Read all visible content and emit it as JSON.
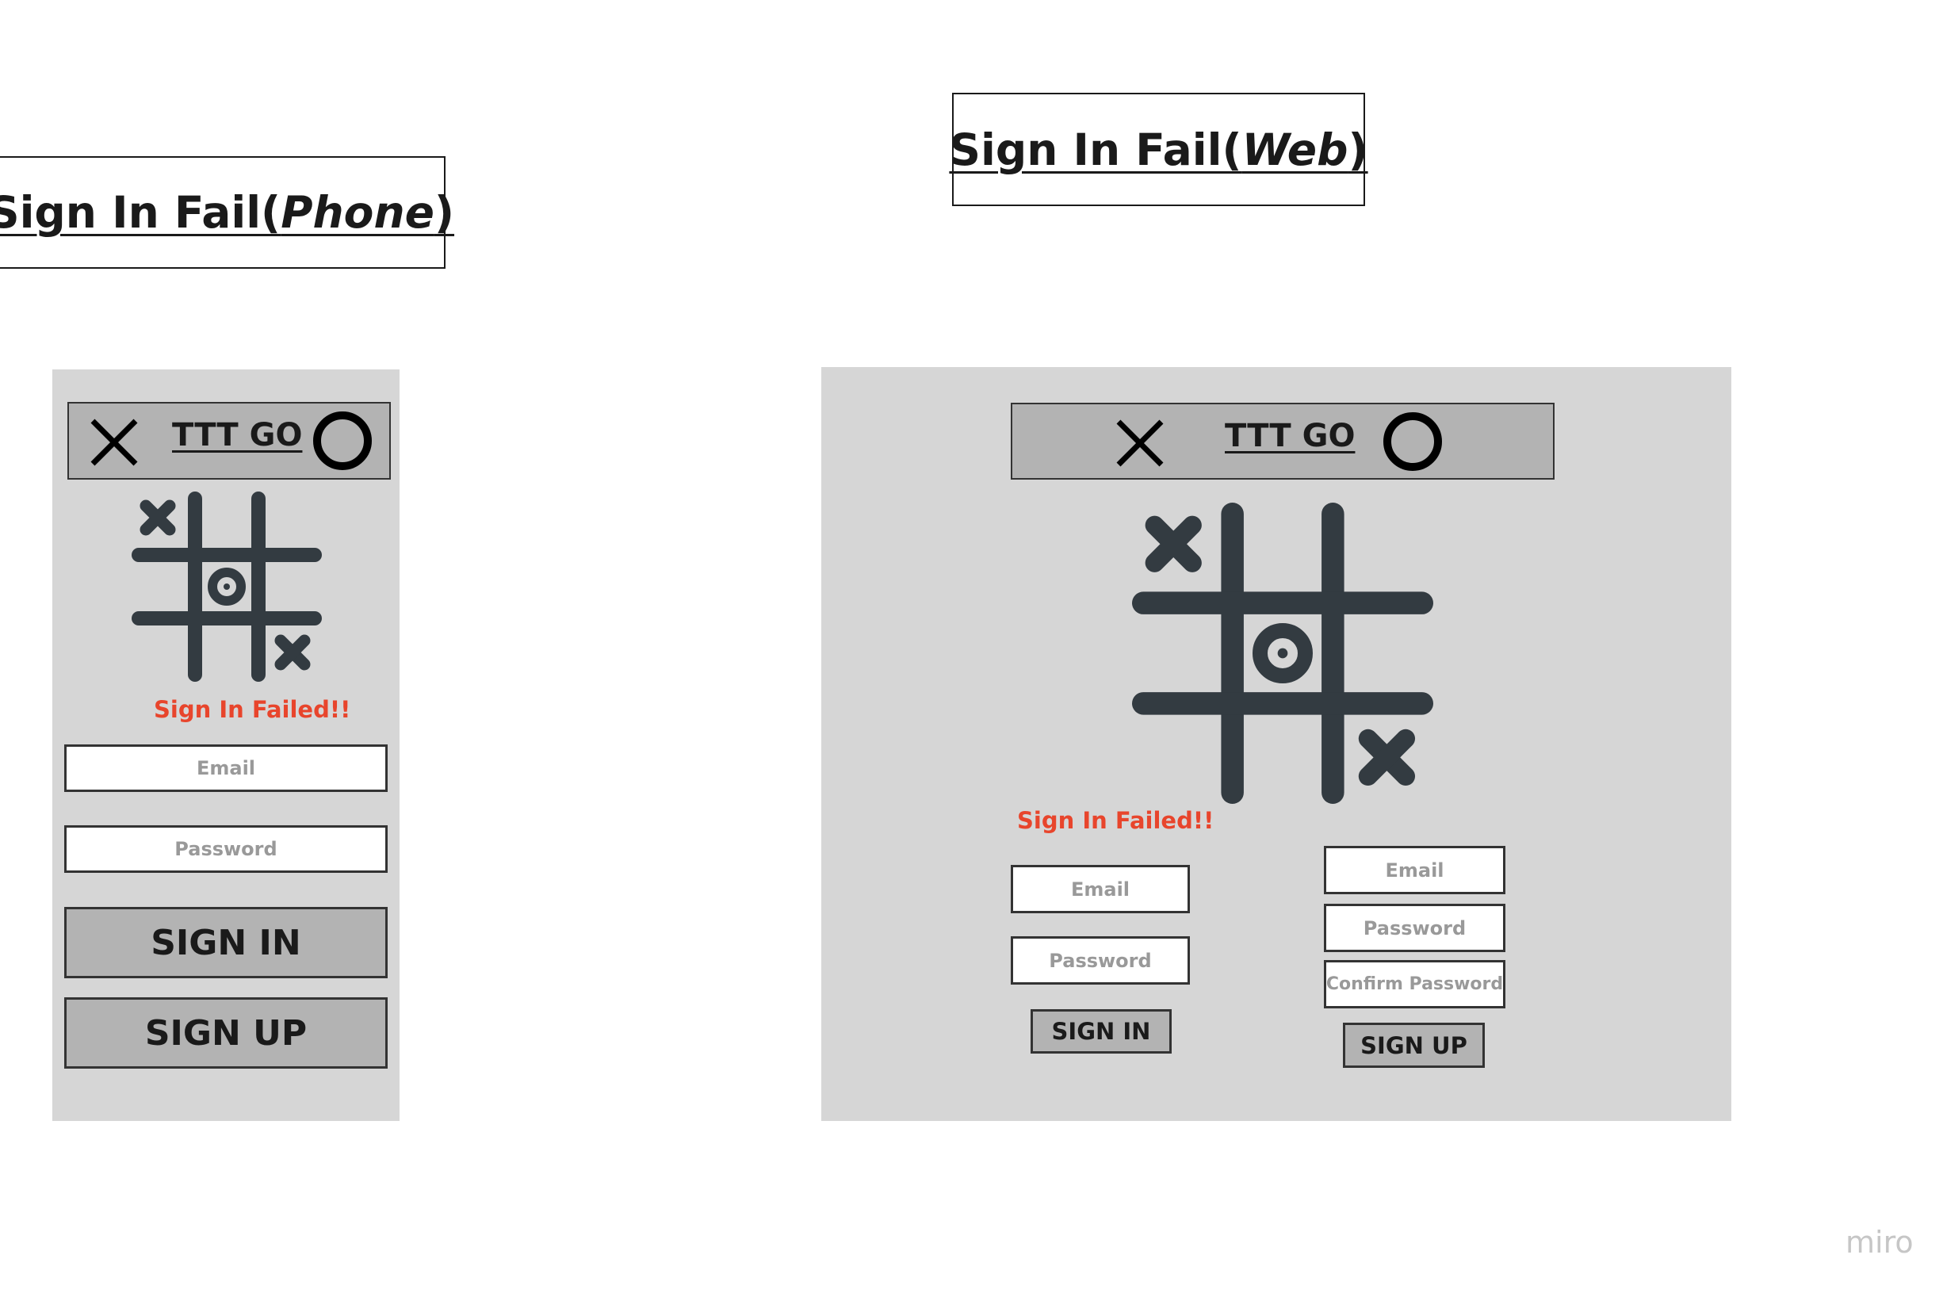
{
  "phone": {
    "title_main": "Sign In Fail(",
    "title_em": "Phone",
    "title_end": ")",
    "brand": "TTT GO",
    "error": "Sign In Failed!!",
    "email_placeholder": "Email",
    "password_placeholder": "Password",
    "signin_label": "SIGN IN",
    "signup_label": "SIGN UP"
  },
  "web": {
    "title_main": "Sign In Fail(",
    "title_em": "Web",
    "title_end": ")",
    "brand": "TTT GO",
    "error": "Sign In Failed!!",
    "signin_form": {
      "email_placeholder": "Email",
      "password_placeholder": "Password",
      "button_label": "SIGN IN"
    },
    "signup_form": {
      "email_placeholder": "Email",
      "password_placeholder": "Password",
      "confirm_placeholder": "Confirm Password",
      "button_label": "SIGN UP"
    }
  },
  "colors": {
    "frame": "#d6d6d6",
    "header": "#b3b3b3",
    "error": "#e8452c",
    "board": "#333b41"
  },
  "watermark": "miro"
}
